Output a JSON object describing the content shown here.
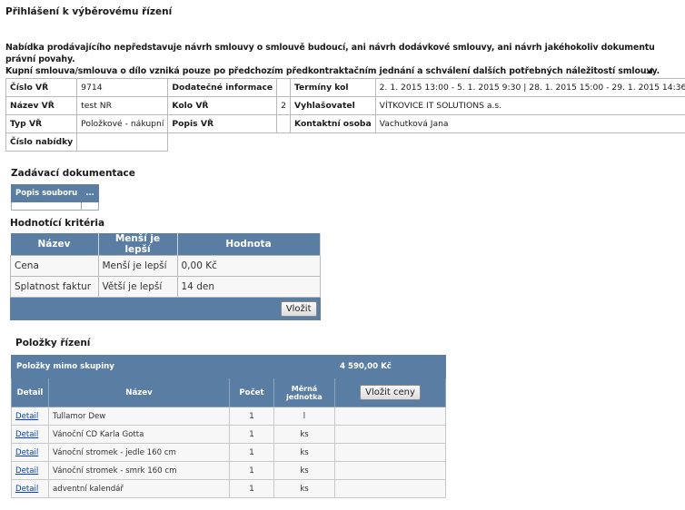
{
  "page": {
    "title": "Přihlášení k výběrovému řízení",
    "disclaimer_line1": "Nabídka prodávajícího nepředstavuje návrh smlouvy o smlouvě budoucí, ani návrh dodávkové smlouvy, ani návrh jakéhokoliv dokumentu právní povahy.",
    "disclaimer_line2": "Kupní smlouva/smlouva o dílo vzniká pouze po předchozím předkontraktačním jednání a schválení dalších potřebných náležitostí smlouvy."
  },
  "info": {
    "cislo_vr_label": "Číslo VŘ",
    "cislo_vr": "9714",
    "dodatecne_label": "Dodatečné informace",
    "dodatecne": "",
    "terminy_label": "Termíny kol",
    "terminy": "2. 1. 2015 13:00 - 5. 1. 2015 9:30  |  28. 1. 2015 15:00 - 29. 1. 2015 14:36",
    "nazev_vr_label": "Název VŘ",
    "nazev_vr": "test NR",
    "kolo_vr_label": "Kolo VŘ",
    "kolo_vr": "2",
    "vyhlasovatel_label": "Vyhlašovatel",
    "vyhlasovatel": "VÍTKOVICE IT SOLUTIONS a.s.",
    "typ_vr_label": "Typ VŘ",
    "typ_vr": "Položkové - nákupní",
    "popis_vr_label": "Popis VŘ",
    "popis_vr": "",
    "kontakt_label": "Kontaktní osoba",
    "kontakt": "Vachutková Jana",
    "cislo_nabidky_label": "Číslo nabídky",
    "cislo_nabidky": ""
  },
  "zadavaci": {
    "heading": "Zadávací dokumentace",
    "col1": "Popis souboru",
    "col2": "..."
  },
  "hodnotici": {
    "heading": "Hodnotící kritéria",
    "columns": [
      "Název",
      "Menší je lepší",
      "Hodnota"
    ],
    "rows": [
      {
        "nazev": "Cena",
        "mensi": "Menší je lepší",
        "hodnota": "0,00 Kč"
      },
      {
        "nazev": "Splatnost faktur",
        "mensi": "Větší je lepší",
        "hodnota": "14 den"
      }
    ],
    "insert_button": "Vložit"
  },
  "polozky": {
    "heading": "Položky řízení",
    "group_label": "Položky mimo skupiny",
    "group_total": "4 590,00 Kč",
    "columns": [
      "Detail",
      "Název",
      "Počet",
      "Měrná jednotka"
    ],
    "insert_prices_button": "Vložit ceny",
    "rows": [
      {
        "detail": "Detail",
        "nazev": "Tullamor Dew",
        "pocet": "1",
        "jednotka": "l"
      },
      {
        "detail": "Detail",
        "nazev": "Vánoční CD Karla Gotta",
        "pocet": "1",
        "jednotka": "ks"
      },
      {
        "detail": "Detail",
        "nazev": "Vánoční stromek - jedle 160 cm",
        "pocet": "1",
        "jednotka": "ks"
      },
      {
        "detail": "Detail",
        "nazev": "Vánoční stromek - smrk 160 cm",
        "pocet": "1",
        "jednotka": "ks"
      },
      {
        "detail": "Detail",
        "nazev": "adventní kalendář",
        "pocet": "1",
        "jednotka": "ks"
      }
    ]
  }
}
